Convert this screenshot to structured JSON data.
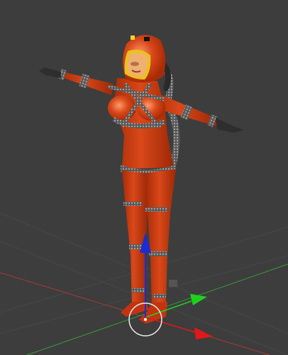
{
  "viewport": {
    "background": "#3d3d3d",
    "grid_color": "#4a4a4a",
    "x_axis_color": "#b23a3a",
    "y_axis_color": "#3aa33a"
  },
  "gizmo": {
    "z_color": "#1a2bd6",
    "y_color": "#1fd11f",
    "x_color": "#e01818",
    "icons": [
      "arrow-z-icon",
      "arrow-y-icon",
      "arrow-x-icon",
      "pivot-ring-icon"
    ]
  },
  "figure": {
    "suit_color": "#c7360c",
    "mesh_color": "#8a8a8a",
    "visor_rim_color": "#e6c21a"
  }
}
